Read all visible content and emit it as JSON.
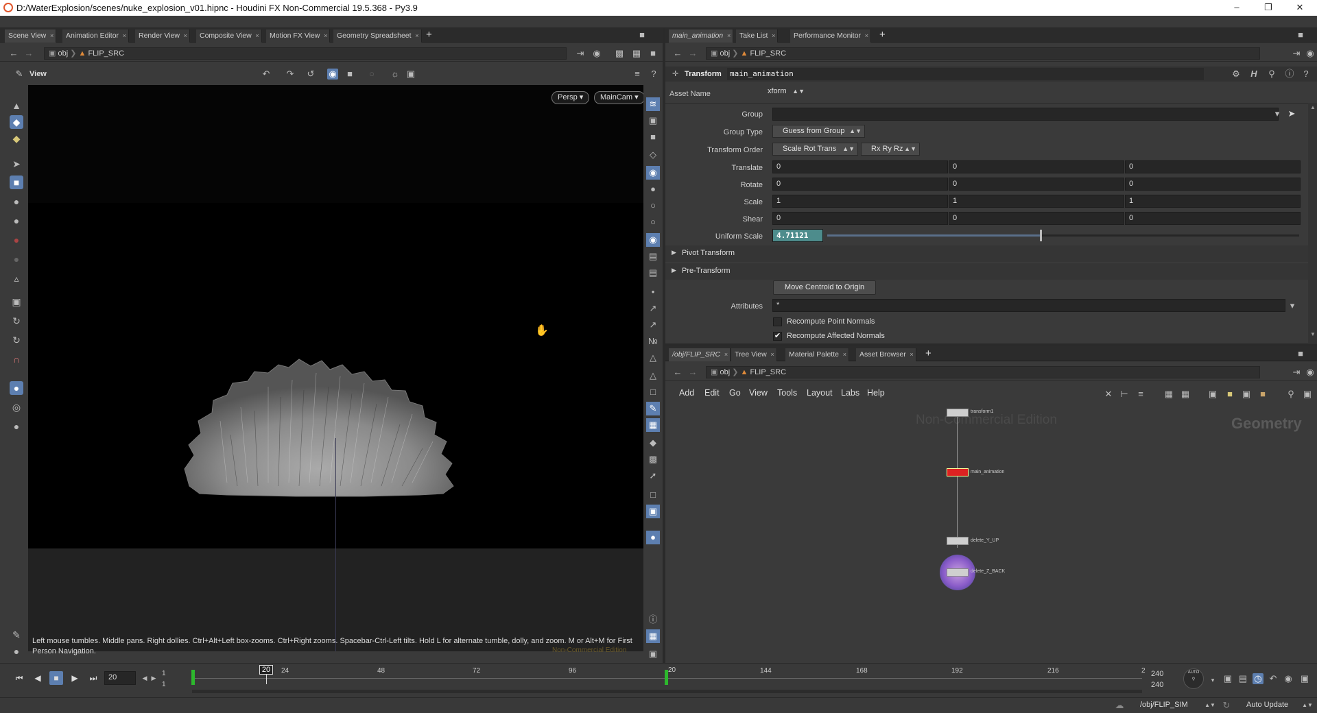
{
  "window": {
    "title": "D:/WaterExplosion/scenes/nuke_explosion_v01.hipnc - Houdini FX Non-Commercial 19.5.368 - Py3.9"
  },
  "left_tabs": [
    "Scene View",
    "Animation Editor",
    "Render View",
    "Composite View",
    "Motion FX View",
    "Geometry Spreadsheet"
  ],
  "left_path": {
    "root": "obj",
    "node": "FLIP_SRC"
  },
  "viewer": {
    "label": "View",
    "persp": "Persp",
    "camera": "MainCam",
    "hint": "Left mouse tumbles. Middle pans. Right dollies. Ctrl+Alt+Left box-zooms. Ctrl+Right zooms. Spacebar-Ctrl-Left tilts. Hold L for alternate tumble, dolly, and zoom.     M or Alt+M for First Person Navigation.",
    "watermark": "Non-Commercial Edition"
  },
  "param_tabs": [
    "main_animation",
    "Take List",
    "Performance Monitor"
  ],
  "param_path": {
    "root": "obj",
    "node": "FLIP_SRC"
  },
  "params": {
    "node_type": "Transform",
    "node_name": "main_animation",
    "asset_name_label": "Asset Name",
    "asset_name": "xform",
    "group_label": "Group",
    "group_value": "",
    "group_type_label": "Group Type",
    "group_type": "Guess from Group",
    "transform_order_label": "Transform Order",
    "transform_order": "Scale Rot Trans",
    "rot_order": "Rx Ry Rz",
    "translate_label": "Translate",
    "translate": [
      "0",
      "0",
      "0"
    ],
    "rotate_label": "Rotate",
    "rotate": [
      "0",
      "0",
      "0"
    ],
    "scale_label": "Scale",
    "scale": [
      "1",
      "1",
      "1"
    ],
    "shear_label": "Shear",
    "shear": [
      "0",
      "0",
      "0"
    ],
    "uniform_scale_label": "Uniform Scale",
    "uniform_scale": "4.71121",
    "uniform_scale_slider": 0.45,
    "pivot_transform": "Pivot Transform",
    "pre_transform": "Pre-Transform",
    "move_centroid": "Move Centroid to Origin",
    "attributes_label": "Attributes",
    "attributes": "*",
    "recompute_point_normals": "Recompute Point Normals",
    "recompute_point_normals_checked": false,
    "recompute_affected_normals": "Recompute Affected Normals",
    "recompute_affected_normals_checked": true
  },
  "network_tabs": [
    "/obj/FLIP_SRC",
    "Tree View",
    "Material Palette",
    "Asset Browser"
  ],
  "network_path": {
    "root": "obj",
    "node": "FLIP_SRC"
  },
  "network_menu": [
    "Add",
    "Edit",
    "Go",
    "View",
    "Tools",
    "Layout",
    "Labs",
    "Help"
  ],
  "network": {
    "watermark": "Non-Commercial Edition",
    "context": "Geometry",
    "nodes": [
      "transform1",
      "main_animation",
      "delete_Y_UP",
      "delete_Z_BACK"
    ]
  },
  "timeline": {
    "current_frame": "20",
    "start": "1",
    "start2": "1",
    "end": "240",
    "end2": "240",
    "ticks": [
      "24",
      "48",
      "72",
      "96",
      "144",
      "168",
      "192",
      "216"
    ],
    "marker": "20",
    "marker_right": "20",
    "tick_end": "2"
  },
  "status": {
    "path": "/obj/FLIP_SIM",
    "update_mode": "Auto Update"
  }
}
